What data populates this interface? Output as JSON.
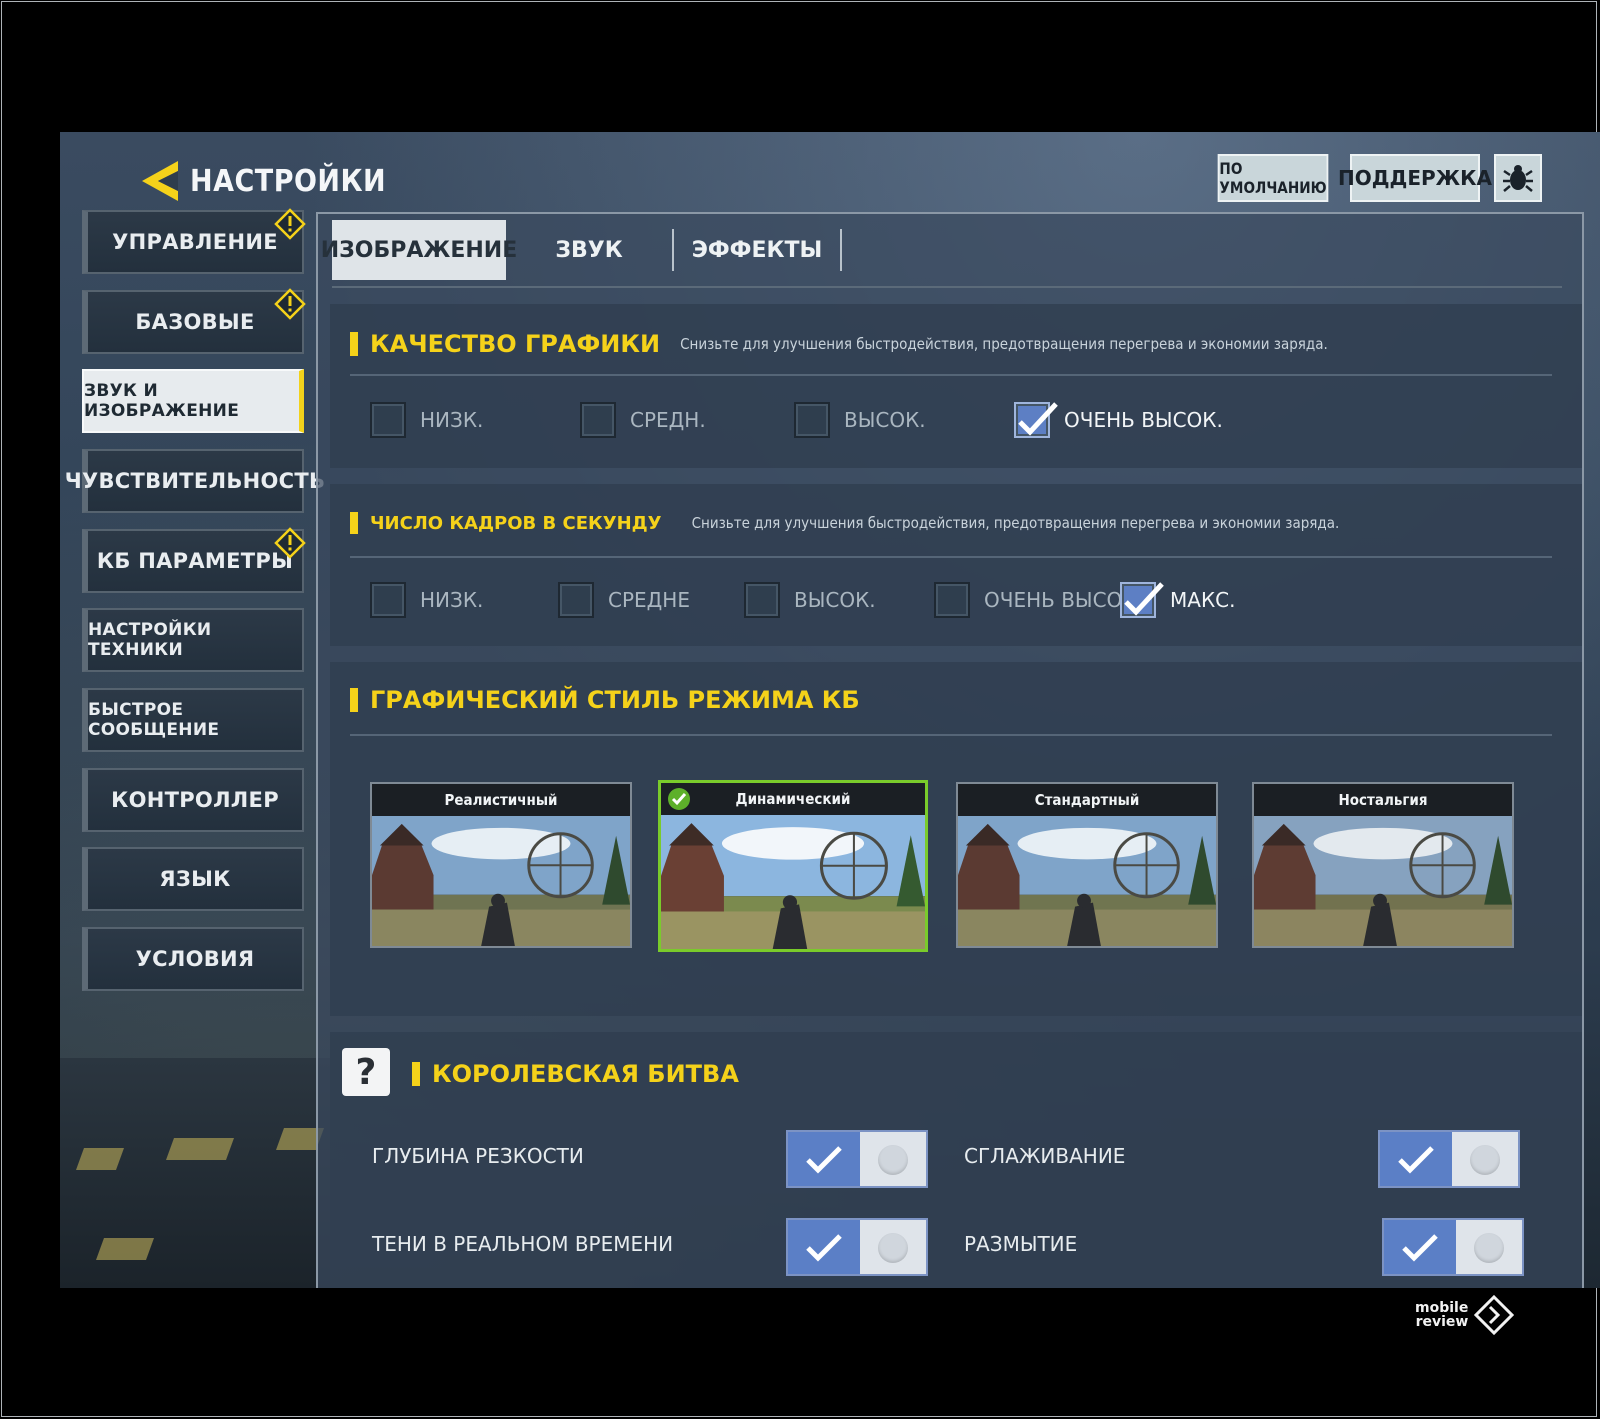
{
  "header": {
    "title": "НАСТРОЙКИ",
    "back_icon": "back-arrow-icon"
  },
  "top_buttons": {
    "defaults": "ПО УМОЛЧАНИЮ",
    "support": "ПОДДЕРЖКА",
    "bug_icon": "bug-icon"
  },
  "sidebar": {
    "items": [
      {
        "label": "УПРАВЛЕНИЕ",
        "warning": true
      },
      {
        "label": "БАЗОВЫЕ",
        "warning": true
      },
      {
        "label": "ЗВУК И ИЗОБРАЖЕНИЕ",
        "active": true
      },
      {
        "label": "ЧУВСТВИТЕЛЬНОСТЬ"
      },
      {
        "label": "КБ ПАРАМЕТРЫ",
        "warning": true
      },
      {
        "label": "НАСТРОЙКИ ТЕХНИКИ"
      },
      {
        "label": "БЫСТРОЕ СООБЩЕНИЕ"
      },
      {
        "label": "КОНТРОЛЛЕР"
      },
      {
        "label": "ЯЗЫК"
      },
      {
        "label": "УСЛОВИЯ"
      }
    ]
  },
  "tabs": [
    {
      "label": "ИЗОБРАЖЕНИЕ",
      "active": true
    },
    {
      "label": "ЗВУК"
    },
    {
      "label": "ЭФФЕКТЫ"
    }
  ],
  "graphics_quality": {
    "title": "КАЧЕСТВО ГРАФИКИ",
    "description": "Снизьте для улучшения быстродействия, предотвращения перегрева и экономии заряда.",
    "options": [
      "НИЗК.",
      "СРЕДН.",
      "ВЫСОК.",
      "ОЧЕНЬ ВЫСОК."
    ],
    "selected": "ОЧЕНЬ ВЫСОК."
  },
  "frame_rate": {
    "title": "ЧИСЛО КАДРОВ В СЕКУНДУ",
    "description": "Снизьте для улучшения быстродействия, предотвращения перегрева и экономии заряда.",
    "options": [
      "НИЗК.",
      "СРЕДНЕ",
      "ВЫСОК.",
      "ОЧЕНЬ ВЫСОК.",
      "МАКС."
    ],
    "selected": "МАКС."
  },
  "br_style": {
    "title": "ГРАФИЧЕСКИЙ СТИЛЬ РЕЖИМА КБ",
    "styles": [
      "Реалистичный",
      "Динамический",
      "Стандартный",
      "Ностальгия"
    ],
    "selected": "Динамический"
  },
  "battle_royale": {
    "title": "КОРОЛЕВСКАЯ БИТВА",
    "help_icon": "?",
    "toggles": [
      {
        "label": "ГЛУБИНА РЕЗКОСТИ",
        "on": true
      },
      {
        "label": "СГЛАЖИВАНИЕ",
        "on": true
      },
      {
        "label": "ТЕНИ В РЕАЛЬНОМ ВРЕМЕНИ",
        "on": true
      },
      {
        "label": "РАЗМЫТИЕ",
        "on": true
      }
    ]
  },
  "watermark": {
    "line1": "mobile",
    "line2": "review"
  },
  "colors": {
    "accent_yellow": "#f5d21a",
    "toggle_blue": "#5b7fc6",
    "selected_green": "#7acb2b"
  }
}
